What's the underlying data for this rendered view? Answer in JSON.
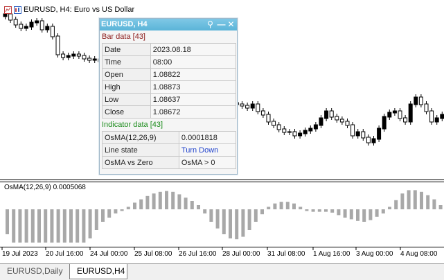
{
  "header": {
    "symbol_timeframe": "EURUSD, H4:",
    "description": "Euro vs US Dollar"
  },
  "indicator_window": {
    "label": "OsMA(12,26,9) 0.0005068"
  },
  "x_axis": {
    "labels": [
      "19 Jul 2023",
      "20 Jul 16:00",
      "24 Jul 00:00",
      "25 Jul 08:00",
      "26 Jul 16:00",
      "28 Jul 00:00",
      "31 Jul 08:00",
      "1 Aug 16:00",
      "3 Aug 00:00",
      "4 Aug 08:00"
    ]
  },
  "tabs": [
    {
      "label": "EURUSD,Daily",
      "active": false
    },
    {
      "label": "EURUSD,H4",
      "active": true
    }
  ],
  "panel": {
    "title": "EURUSD, H4",
    "bar_section": "Bar data [43]",
    "bar_rows": [
      {
        "label": "Date",
        "value": "2023.08.18"
      },
      {
        "label": "Time",
        "value": "08:00"
      },
      {
        "label": "Open",
        "value": "1.08822"
      },
      {
        "label": "High",
        "value": "1.08873"
      },
      {
        "label": "Low",
        "value": "1.08637"
      },
      {
        "label": "Close",
        "value": "1.08672"
      }
    ],
    "indicator_section": "Indicator data [43]",
    "indicator_rows": [
      {
        "label": "OsMA(12,26,9)",
        "value": "0.0001818",
        "highlight": false
      },
      {
        "label": "Line state",
        "value": "Turn Down",
        "highlight": true
      },
      {
        "label": "OsMA vs Zero",
        "value": "OsMA > 0",
        "highlight": false
      }
    ]
  },
  "colors": {
    "panel_title_bg": "#5bb4d8",
    "histogram": "#a8a8a8",
    "candles": "#000000",
    "bar_section_text": "#8b1a1a",
    "indicator_section_text": "#1a8b1a",
    "line_state_text": "#2244cc"
  },
  "chart_data": {
    "type": "bar",
    "title": "OsMA(12,26,9) 0.0005068",
    "values": [
      -3,
      -4,
      -4,
      -4,
      -4,
      -4,
      -4,
      -4,
      -4,
      -4,
      -4,
      -4,
      -4,
      -3.5,
      -2.5,
      -1.5,
      -1,
      -0.5,
      -0.2,
      0.3,
      0.8,
      1.2,
      1.6,
      1.9,
      2.1,
      2.2,
      2.1,
      1.8,
      1.4,
      1,
      0.5,
      -0.5,
      -1.5,
      -2.3,
      -3,
      -3.5,
      -3.6,
      -3.3,
      -2.5,
      -1.5,
      -0.6,
      0.3,
      0.7,
      0.9,
      0.9,
      0.7,
      0.3,
      -0.2,
      -0.3,
      -0.3,
      -0.3,
      -0.4,
      -0.7,
      -1,
      -1.2,
      -1.4,
      -1.5,
      -1.3,
      -0.9,
      -0.5,
      0.3,
      1.1,
      1.9,
      2.3,
      2.3,
      2.1,
      1.7,
      1.2,
      0.5,
      0.2
    ]
  }
}
